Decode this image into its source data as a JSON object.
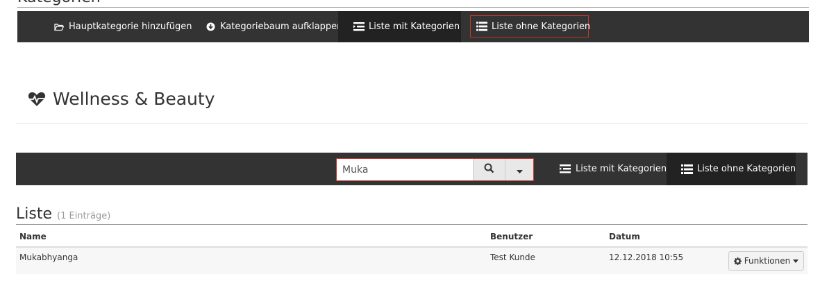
{
  "page": {
    "heading": "Kategorien"
  },
  "topbar": {
    "items": [
      {
        "label": "Hauptkategorie hinzufügen",
        "icon": "folder-open-icon"
      },
      {
        "label": "Kategoriebaum aufklappen",
        "icon": "circle-arrow-down-icon"
      },
      {
        "label": "Liste mit Kategorien",
        "icon": "indented-list-icon"
      },
      {
        "label": "Liste ohne Kategorien",
        "icon": "list-icon"
      }
    ]
  },
  "category": {
    "title": "Wellness & Beauty",
    "icon": "heartbeat-icon"
  },
  "listbar": {
    "search": {
      "value": "Muka"
    },
    "items": [
      {
        "label": "Liste mit Kategorien",
        "icon": "indented-list-icon"
      },
      {
        "label": "Liste ohne Kategorien",
        "icon": "list-icon"
      }
    ]
  },
  "list": {
    "title": "Liste",
    "count": "(1 Einträge)",
    "columns": [
      "Name",
      "Benutzer",
      "Datum"
    ],
    "rows": [
      {
        "name": "Mukabhyanga",
        "user": "Test Kunde",
        "date": "12.12.2018 10:55",
        "action_label": "Funktionen"
      }
    ]
  },
  "colors": {
    "navbar": "#333333",
    "active": "#222222",
    "outline": "#c0392b"
  }
}
